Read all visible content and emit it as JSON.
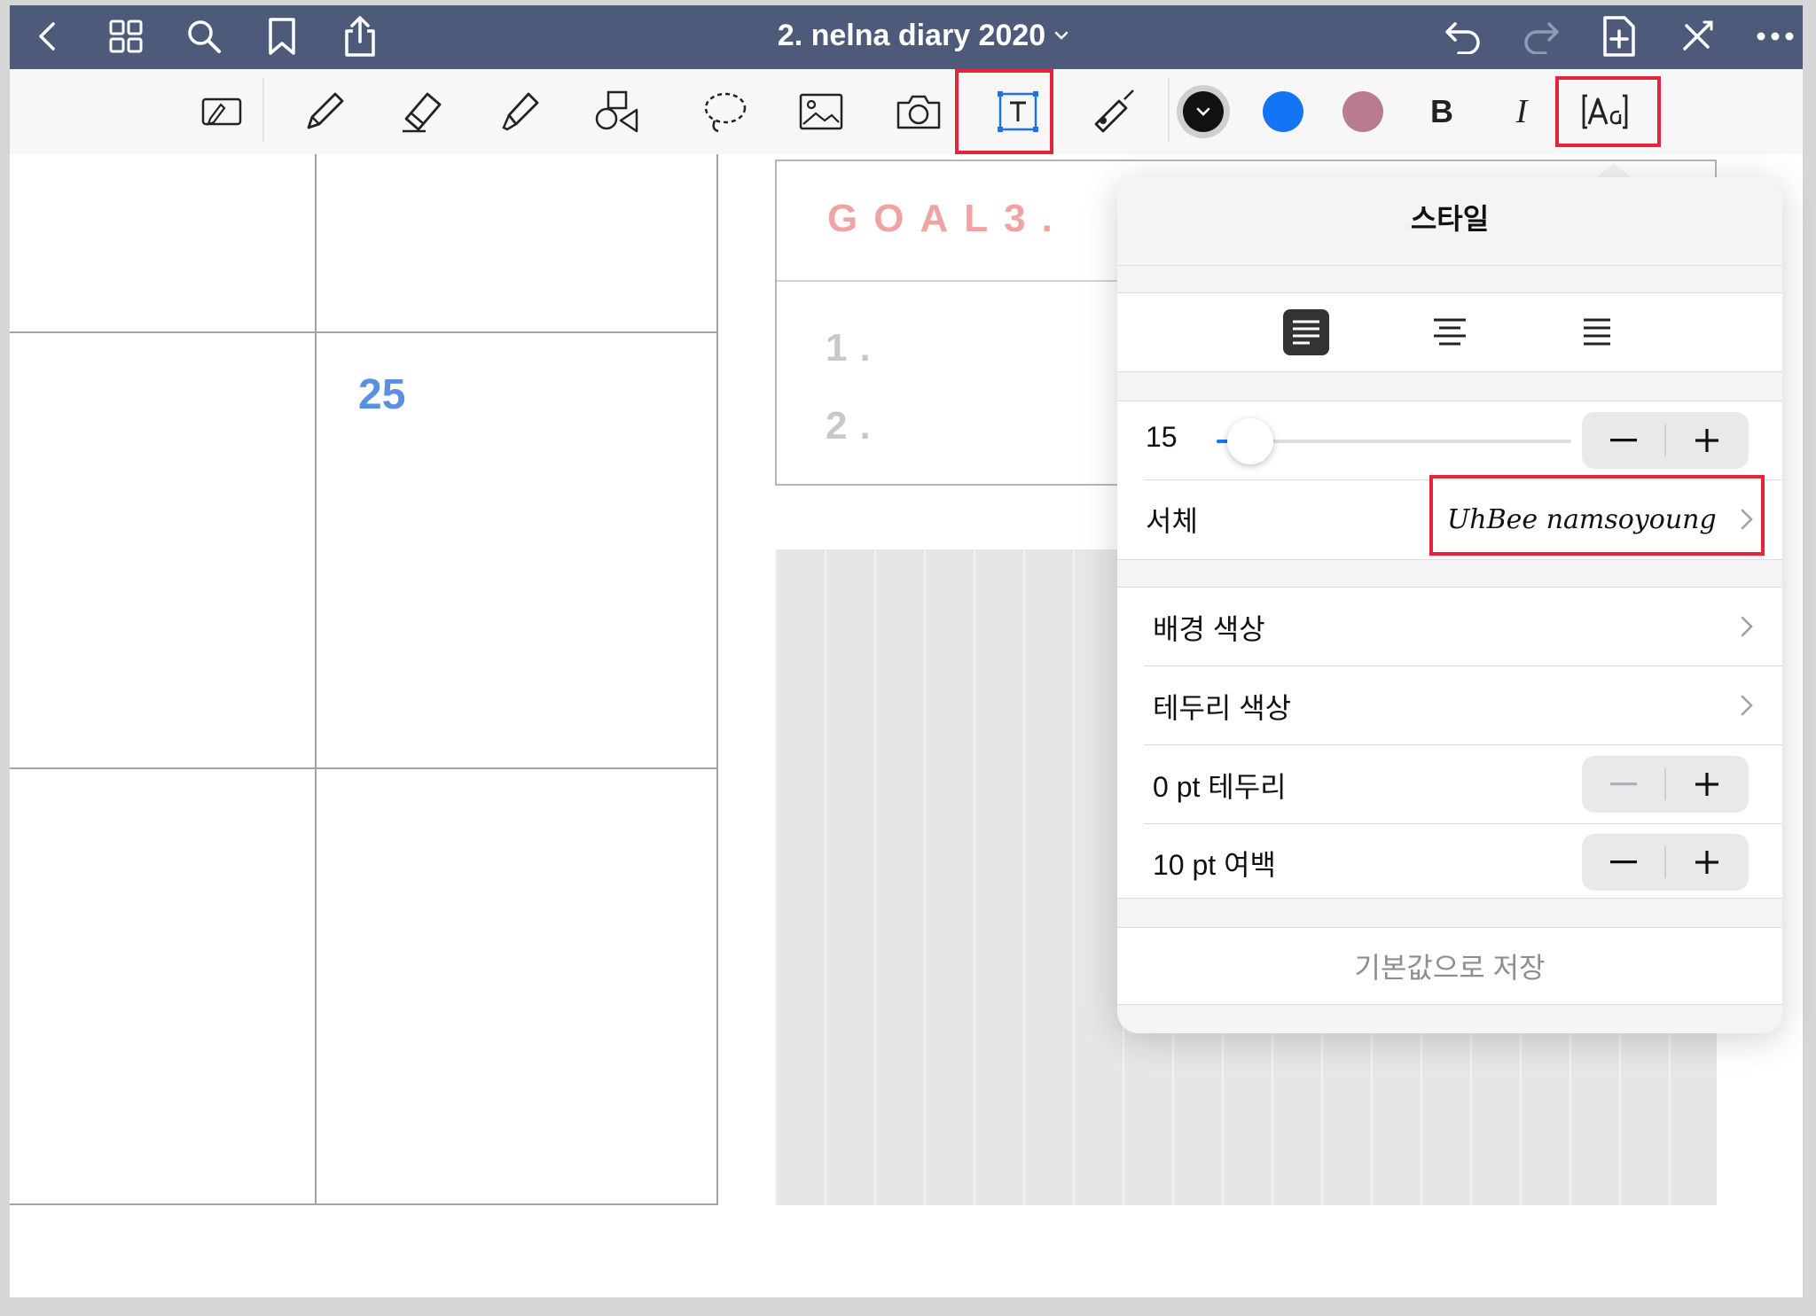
{
  "nav": {
    "title": "2. nelna diary 2020",
    "icons": [
      "back-icon",
      "grid-icon",
      "search-icon",
      "bookmark-icon",
      "share-icon",
      "undo-icon",
      "redo-icon",
      "add-page-icon",
      "close-tools-icon",
      "more-icon"
    ]
  },
  "toolbar": {
    "tools": [
      "read-only-icon",
      "pen-icon",
      "eraser-icon",
      "highlighter-icon",
      "shapes-icon",
      "lasso-icon",
      "image-icon",
      "camera-icon",
      "text-tool-icon",
      "laser-pointer-icon"
    ],
    "colors": [
      "#111111",
      "#1475f4",
      "#b97c8f"
    ],
    "bold_label": "B",
    "italic_label": "I",
    "style_icon": "text-style-icon",
    "highlight_color": "#e5243b"
  },
  "page": {
    "day_number": "25",
    "goal_title": "GOAL3.",
    "goal_items": [
      "1.",
      "2."
    ],
    "day_color": "#5b8fe0",
    "goal_color": "#f0a3a3"
  },
  "style_panel": {
    "title": "스타일",
    "alignment_options": [
      "align-left-icon",
      "align-center-icon",
      "align-right-icon"
    ],
    "selected_alignment": "align-left-icon",
    "font_size": "15",
    "font_size_slider_fraction": 0.02,
    "font_label": "서체",
    "font_value": "UhBee namsoyoung",
    "background_color_label": "배경 색상",
    "border_color_label": "테두리 색상",
    "border_width_label": "0 pt 테두리",
    "padding_label": "10 pt 여백",
    "save_default_label": "기본값으로 저장"
  }
}
